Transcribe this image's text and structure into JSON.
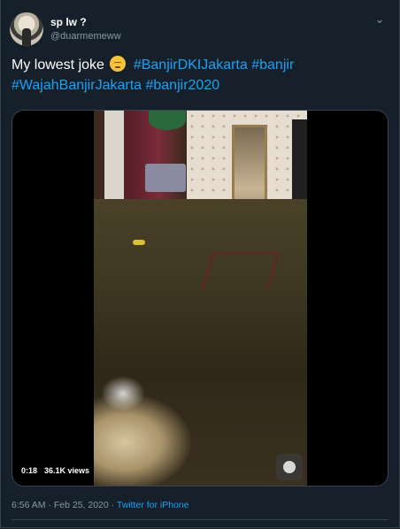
{
  "author": {
    "name": "sp lw ?",
    "handle": "@duarmemeww"
  },
  "tweet": {
    "text_plain": "My lowest joke",
    "emoji": "pensive-face-emoji",
    "hashtags": [
      "#BanjirDKIJakarta",
      "#banjir",
      "#WajahBanjirJakarta",
      "#banjir2020"
    ]
  },
  "video": {
    "time": "0:18",
    "views": "36.1K views"
  },
  "meta": {
    "timestamp": "6:56 AM · Feb 25, 2020 ·",
    "source": "Twitter for iPhone"
  },
  "colors": {
    "background": "#15202b",
    "accent": "#1da1f2",
    "muted": "#8899a6",
    "border": "#38444d"
  },
  "icons": {
    "menu": "chevron-down-icon"
  }
}
